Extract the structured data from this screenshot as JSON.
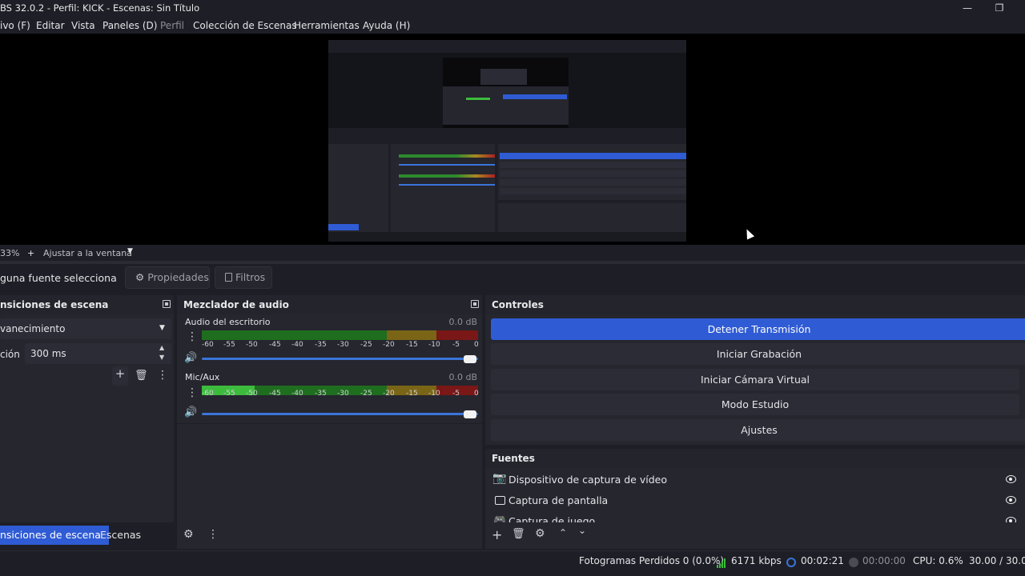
{
  "window": {
    "title": "BS 32.0.2 - Perfil: KICK - Escenas: Sin Título"
  },
  "menu": [
    "ivo (F)",
    "Editar",
    "Vista",
    "Paneles (D)",
    "Perfil",
    "Colección de Escenas",
    "Herramientas",
    "Ayuda (H)"
  ],
  "zoom": {
    "level": "33%",
    "plus": "+",
    "fit_label": "Ajustar a la ventana"
  },
  "source_bar": {
    "no_source": "guna fuente selecciona",
    "properties": "Propiedades",
    "filters": "Filtros"
  },
  "transitions": {
    "title": "nsiciones de escena",
    "selected": "vanecimiento",
    "duration_label": "ción",
    "duration_value": "300 ms"
  },
  "mixer": {
    "title": "Mezclador de audio",
    "ticks": [
      "-60",
      "-55",
      "-50",
      "-45",
      "-40",
      "-35",
      "-30",
      "-25",
      "-20",
      "-15",
      "-10",
      "-5",
      "0"
    ],
    "channels": [
      {
        "name": "Audio del escritorio",
        "db": "0.0 dB",
        "level": 0.0,
        "volume": 1.0
      },
      {
        "name": "Mic/Aux",
        "db": "0.0 dB",
        "level": 0.19,
        "volume": 1.0
      }
    ]
  },
  "controls": {
    "title": "Controles",
    "buttons": [
      "Detener Transmisión",
      "Iniciar Grabación",
      "Iniciar Cámara Virtual",
      "Modo Estudio",
      "Ajustes"
    ]
  },
  "sources": {
    "title": "Fuentes",
    "items": [
      {
        "name": "Dispositivo de captura de vídeo",
        "icon": "camera-icon"
      },
      {
        "name": "Captura de pantalla",
        "icon": "monitor-icon"
      },
      {
        "name": "Captura de juego",
        "icon": "gamepad-icon"
      }
    ]
  },
  "tabs": {
    "transitions": "nsiciones de escena",
    "scenes": "Escenas"
  },
  "status": {
    "dropped": "Fotogramas Perdidos 0 (0.0%)",
    "bitrate": "6171 kbps",
    "stream_time": "00:02:21",
    "rec_time": "00:00:00",
    "cpu": "CPU: 0.6%",
    "fps": "30.00 / 30.00"
  },
  "colors": {
    "accent": "#2f5bd4",
    "meter_green": "#3dbb3d",
    "meter_yellow": "#c9a227",
    "meter_red": "#c92a2a"
  }
}
